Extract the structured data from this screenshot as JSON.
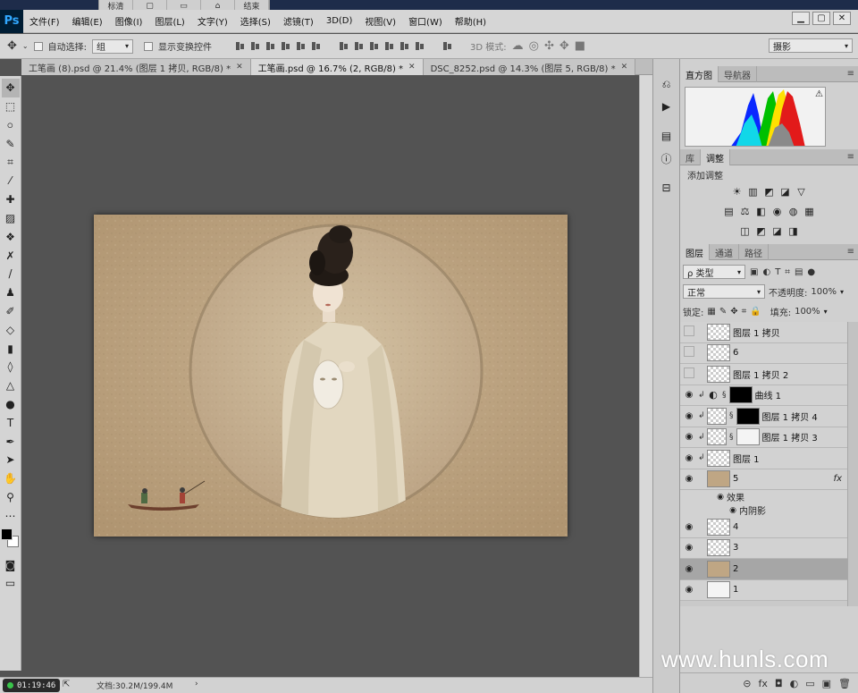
{
  "capture_bar": {
    "items": [
      "标清",
      "▢",
      "▭",
      "⌂",
      "结束"
    ]
  },
  "app": {
    "logo": "Ps"
  },
  "menu": [
    "文件(F)",
    "编辑(E)",
    "图像(I)",
    "图层(L)",
    "文字(Y)",
    "选择(S)",
    "滤镜(T)",
    "3D(D)",
    "视图(V)",
    "窗口(W)",
    "帮助(H)"
  ],
  "window_controls": [
    "▁",
    "▢",
    "✕"
  ],
  "options": {
    "auto_select_label": "自动选择:",
    "auto_select_value": "组",
    "show_transform_label": "显示变换控件",
    "mode_3d_label": "3D 模式:",
    "workspace": "摄影"
  },
  "tabs": [
    {
      "label": "工笔画 (8).psd @ 21.4% (图层 1 拷贝, RGB/8) *",
      "close": "✕"
    },
    {
      "label": "工笔画.psd @ 16.7% (2, RGB/8) *",
      "close": "✕"
    },
    {
      "label": "DSC_8252.psd @ 14.3% (图层 5, RGB/8) *",
      "close": "✕"
    }
  ],
  "status": {
    "timer": "01:19:46",
    "doc_size": "文档:30.2M/199.4M",
    "arrow": "›"
  },
  "panels": {
    "top_tabs": [
      "直方图",
      "导航器"
    ],
    "mid_tabs": [
      "库",
      "调整"
    ],
    "adjust_title": "添加调整",
    "adj_row1": [
      "☀",
      "▥",
      "◩",
      "◪",
      "▽"
    ],
    "adj_row2": [
      "▤",
      "⚖",
      "◧",
      "◉",
      "◍",
      "▦"
    ],
    "adj_row3": [
      "◫",
      "◩",
      "◪",
      "◨"
    ],
    "layer_tabs": [
      "图层",
      "通道",
      "路径"
    ],
    "filter_label": "ρ 类型",
    "blend_mode": "正常",
    "opacity_label": "不透明度:",
    "opacity_value": "100%",
    "lock_label": "锁定:",
    "fill_label": "填充:",
    "fill_value": "100%"
  },
  "layers": [
    {
      "name": "图层 1 拷贝",
      "visible": false,
      "thumb": "checker",
      "smart": true
    },
    {
      "name": "6",
      "visible": false,
      "thumb": "checker"
    },
    {
      "name": "图层 1 拷贝 2",
      "visible": false,
      "thumb": "checker",
      "smart": true
    },
    {
      "name": "曲线 1",
      "visible": true,
      "clip": true,
      "adjustment": true,
      "mask": "black"
    },
    {
      "name": "图层 1 拷贝 4",
      "visible": true,
      "clip": true,
      "thumb": "checker",
      "mask": "black"
    },
    {
      "name": "图层 1 拷贝 3",
      "visible": true,
      "clip": true,
      "thumb": "checker",
      "mask": "white"
    },
    {
      "name": "图层 1",
      "visible": true,
      "clip": true,
      "thumb": "checker"
    },
    {
      "name": "5",
      "visible": true,
      "thumb": "tan",
      "fx": "fx",
      "effects_label": "效果",
      "effects": [
        "内阴影"
      ]
    },
    {
      "name": "4",
      "visible": true,
      "thumb": "checker"
    },
    {
      "name": "3",
      "visible": true,
      "thumb": "checker"
    },
    {
      "name": "2",
      "visible": true,
      "thumb": "tan",
      "selected": true
    },
    {
      "name": "1",
      "visible": true,
      "thumb": "white"
    }
  ],
  "layer_footer": [
    "⊝",
    "fx",
    "◘",
    "◐",
    "▭",
    "▣",
    "🗑"
  ],
  "watermark": "www.hunls.com",
  "colors": {
    "accent": "#31a8ff",
    "canvas_bg": "#535353",
    "paper": "#bfa684"
  }
}
